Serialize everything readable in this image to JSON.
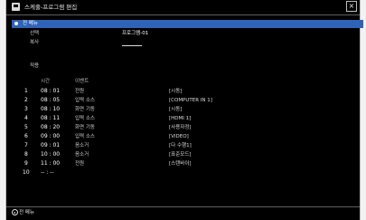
{
  "window": {
    "title": "스케줄-프로그램 편집",
    "close_label": "×"
  },
  "menu": {
    "selected_label": "전 메뉴"
  },
  "fields": [
    {
      "label": "선택",
      "value": "프로그램-01"
    },
    {
      "label": "복사",
      "value": ""
    }
  ],
  "section": {
    "title": "적용"
  },
  "columns": {
    "time": "시간",
    "event": "이벤트"
  },
  "rows": [
    {
      "num": "1",
      "time": "08 : 01",
      "event": "전원",
      "param": "[시동]"
    },
    {
      "num": "2",
      "time": "08 : 05",
      "event": "입력 소스",
      "param": "[COMPUTER IN 1]"
    },
    {
      "num": "3",
      "time": "08 : 10",
      "event": "화면 기동",
      "param": "[시동]"
    },
    {
      "num": "4",
      "time": "08 : 11",
      "event": "입력 소스",
      "param": "[HDMI 1]"
    },
    {
      "num": "5",
      "time": "08 : 20",
      "event": "화면 기동",
      "param": "[사용자정]"
    },
    {
      "num": "6",
      "time": "09 : 00",
      "event": "입력 소스",
      "param": "[VIDEO]"
    },
    {
      "num": "7",
      "time": "09 : 01",
      "event": "음소거",
      "param": "[다 수행1]"
    },
    {
      "num": "8",
      "time": "10 : 00",
      "event": "음소거",
      "param": "[표준모드]"
    },
    {
      "num": "9",
      "time": "11 : 00",
      "event": "전원",
      "param": "[스탠바이]"
    },
    {
      "num": "10",
      "time": "-- : --",
      "event": "",
      "param": ""
    }
  ],
  "footer": {
    "label": "전 메뉴"
  }
}
